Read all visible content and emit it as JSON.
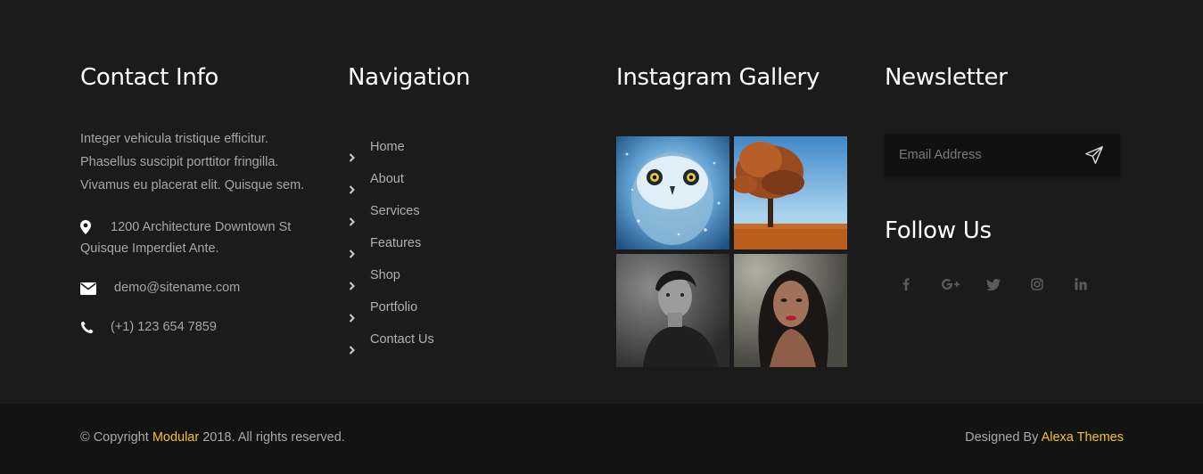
{
  "colors": {
    "background": "#1b1b1c",
    "bottom_bar": "#131313",
    "accent": "#f5c518",
    "title": "#ffffff",
    "text": "#a6a6a6"
  },
  "contact": {
    "title": "Contact Info",
    "about": "Integer vehicula tristique efficitur. Phasellus suscipit porttitor fringilla. Vivamus eu placerat elit. Quisque sem.",
    "address": "1200 Architecture Downtown St Quisque Imperdiet Ante.",
    "email": "demo@sitename.com",
    "phone": "(+1) 123 654 7859",
    "icons": [
      "map-marker-icon",
      "envelope-icon",
      "phone-icon"
    ]
  },
  "navigation": {
    "title": "Navigation",
    "items": [
      {
        "label": "Home"
      },
      {
        "label": "About"
      },
      {
        "label": "Services"
      },
      {
        "label": "Features"
      },
      {
        "label": "Shop"
      },
      {
        "label": "Portfolio"
      },
      {
        "label": "Contact Us"
      }
    ]
  },
  "instagram": {
    "title": "Instagram Gallery",
    "images": [
      "owl-photo",
      "autumn-tree-photo",
      "man-portrait-photo",
      "woman-portrait-photo"
    ]
  },
  "newsletter": {
    "title": "Newsletter",
    "placeholder": "Email Address",
    "send_icon": "paper-plane-icon"
  },
  "follow": {
    "title": "Follow Us",
    "icons": [
      "facebook-icon",
      "google-plus-icon",
      "twitter-icon",
      "instagram-icon",
      "linkedin-icon"
    ]
  },
  "bottom": {
    "copyright_prefix": "© Copyright ",
    "brand": "Modular",
    "copyright_suffix": " 2018. All rights reserved.",
    "designed_prefix": "Designed By ",
    "designer": "Alexa Themes"
  }
}
